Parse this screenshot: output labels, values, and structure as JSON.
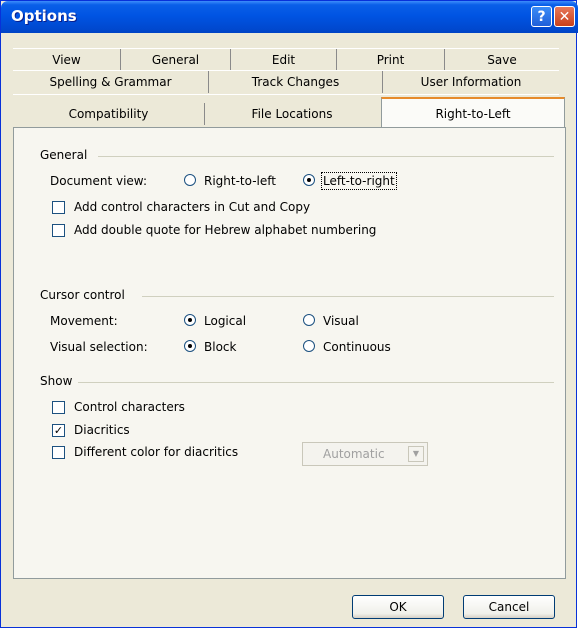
{
  "window": {
    "title": "Options"
  },
  "tabs": {
    "row1": [
      "View",
      "General",
      "Edit",
      "Print",
      "Save"
    ],
    "row2": [
      "Spelling & Grammar",
      "Track Changes",
      "User Information"
    ],
    "row3": [
      "Compatibility",
      "File Locations",
      "Right-to-Left"
    ],
    "active": "Right-to-Left"
  },
  "general": {
    "heading": "General",
    "document_view_label": "Document view:",
    "rtl_label": "Right-to-left",
    "ltr_label": "Left-to-right",
    "selected": "Left-to-right",
    "add_control_chars": {
      "label": "Add control characters in Cut and Copy",
      "checked": false
    },
    "add_double_quote": {
      "label": "Add double quote for Hebrew alphabet numbering",
      "checked": false
    }
  },
  "cursor": {
    "heading": "Cursor control",
    "movement_label": "Movement:",
    "logical_label": "Logical",
    "visual_label": "Visual",
    "movement_selected": "Logical",
    "visual_selection_label": "Visual selection:",
    "block_label": "Block",
    "continuous_label": "Continuous",
    "selection_selected": "Block"
  },
  "show": {
    "heading": "Show",
    "control_chars": {
      "label": "Control characters",
      "checked": false
    },
    "diacritics": {
      "label": "Diacritics",
      "checked": true
    },
    "diff_color": {
      "label": "Different color for diacritics",
      "checked": false
    },
    "color_select": {
      "value": "Automatic",
      "enabled": false
    }
  },
  "buttons": {
    "ok": "OK",
    "cancel": "Cancel"
  }
}
